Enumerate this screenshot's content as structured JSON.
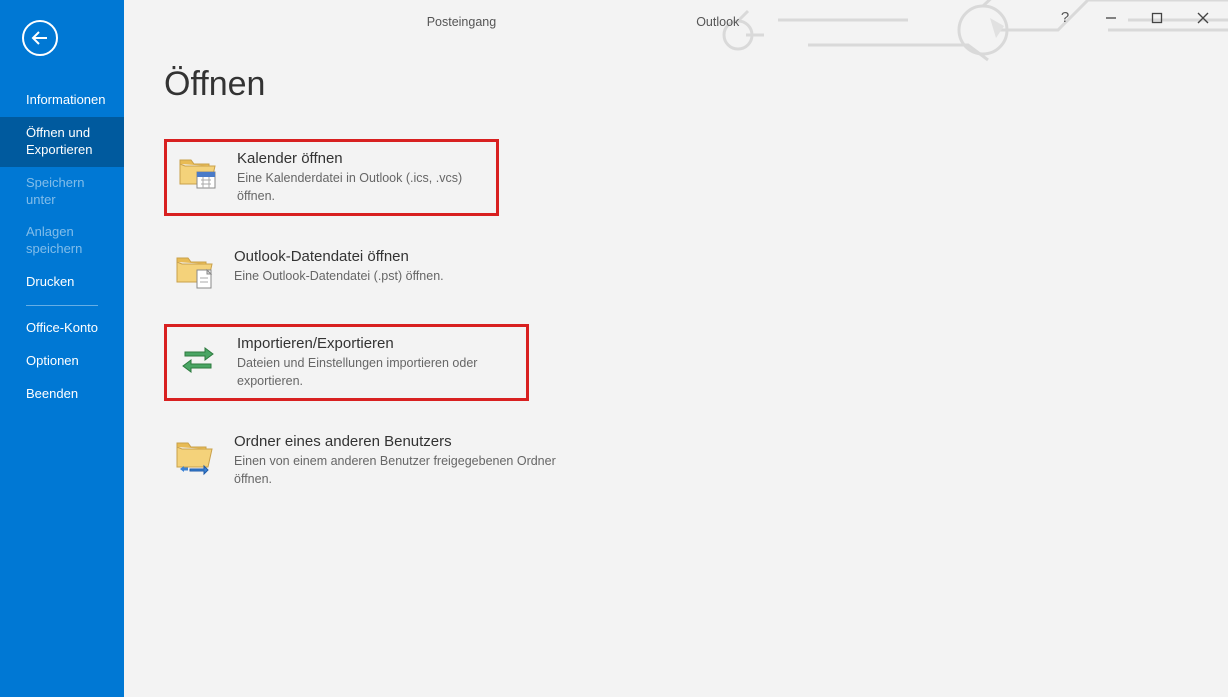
{
  "titlebar": {
    "context": "Posteingang",
    "app": "Outlook"
  },
  "sidebar": {
    "items": [
      {
        "label": "Informationen",
        "state": "normal"
      },
      {
        "label": "Öffnen und Exportieren",
        "state": "active"
      },
      {
        "label": "Speichern unter",
        "state": "dim"
      },
      {
        "label": "Anlagen speichern",
        "state": "dim"
      },
      {
        "label": "Drucken",
        "state": "normal"
      },
      {
        "label": "Office-Konto",
        "state": "normal"
      },
      {
        "label": "Optionen",
        "state": "normal"
      },
      {
        "label": "Beenden",
        "state": "normal"
      }
    ]
  },
  "page": {
    "title": "Öffnen",
    "options": [
      {
        "title": "Kalender öffnen",
        "desc": "Eine Kalenderdatei in Outlook (.ics, .vcs) öffnen."
      },
      {
        "title": "Outlook-Datendatei öffnen",
        "desc": "Eine Outlook-Datendatei (.pst) öffnen."
      },
      {
        "title": "Importieren/Exportieren",
        "desc": "Dateien und Einstellungen importieren oder exportieren."
      },
      {
        "title": "Ordner eines anderen Benutzers",
        "desc": "Einen von einem anderen Benutzer freigegebenen Ordner öffnen."
      }
    ]
  }
}
